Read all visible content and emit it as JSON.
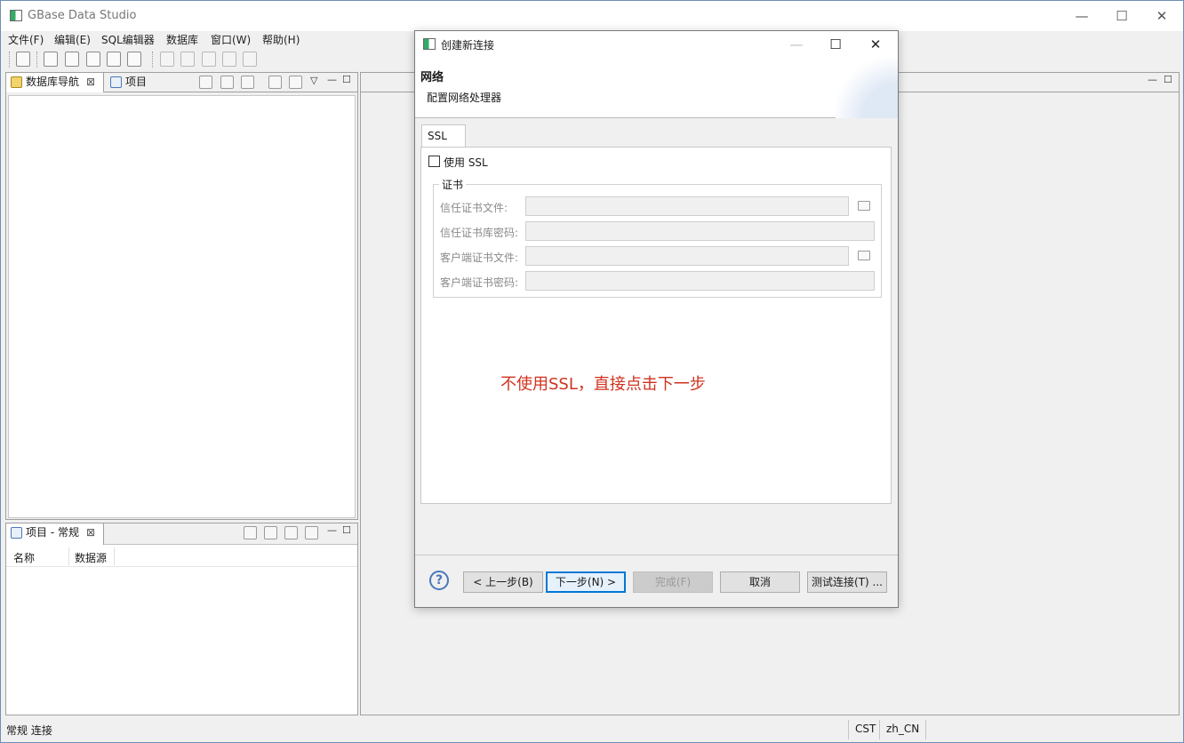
{
  "app": {
    "title": "GBase Data Studio",
    "window_controls": {
      "minimize": "—",
      "maximize": "☐",
      "close": "✕"
    }
  },
  "menu": {
    "items": [
      "文件(F)",
      "编辑(E)",
      "SQL编辑器",
      "数据库",
      "窗口(W)",
      "帮助(H)"
    ]
  },
  "toolbar": {
    "icons": [
      "new-connection-icon",
      "connect-icon",
      "disconnect-icon",
      "new-script-icon",
      "open-script-icon",
      "recent-script-icon",
      "save-icon",
      "save-as-icon",
      "undo-icon",
      "redo-icon",
      "revert-icon"
    ]
  },
  "nav_panel": {
    "tab_db_nav": "数据库导航",
    "tab_project": "项目",
    "close_glyph": "⊠",
    "min_glyph": "—",
    "max_glyph": "☐",
    "menu_glyph": "▽"
  },
  "project_panel": {
    "tab_label": "项目 - 常规",
    "close_glyph": "⊠",
    "col_name": "名称",
    "col_datasource": "数据源"
  },
  "statusbar": {
    "left": "常规 连接",
    "timezone": "CST",
    "locale": "zh_CN"
  },
  "dialog": {
    "title": "创建新连接",
    "header_title": "网络",
    "header_desc": "配置网络处理器",
    "tab_ssl": "SSL",
    "use_ssl_label": "使用 SSL",
    "use_ssl_checked": false,
    "cert_group_label": "证书",
    "fields": {
      "trust_cert_file": "信任证书文件:",
      "trust_store_password": "信任证书库密码:",
      "client_cert_file": "客户端证书文件:",
      "client_cert_password": "客户端证书密码:"
    },
    "annotation": "不使用SSL，直接点击下一步",
    "buttons": {
      "help": "?",
      "back": "< 上一步(B)",
      "next": "下一步(N) >",
      "finish": "完成(F)",
      "cancel": "取消",
      "test": "测试连接(T) ..."
    },
    "window_controls": {
      "minimize": "—",
      "maximize": "☐",
      "close": "✕"
    }
  }
}
